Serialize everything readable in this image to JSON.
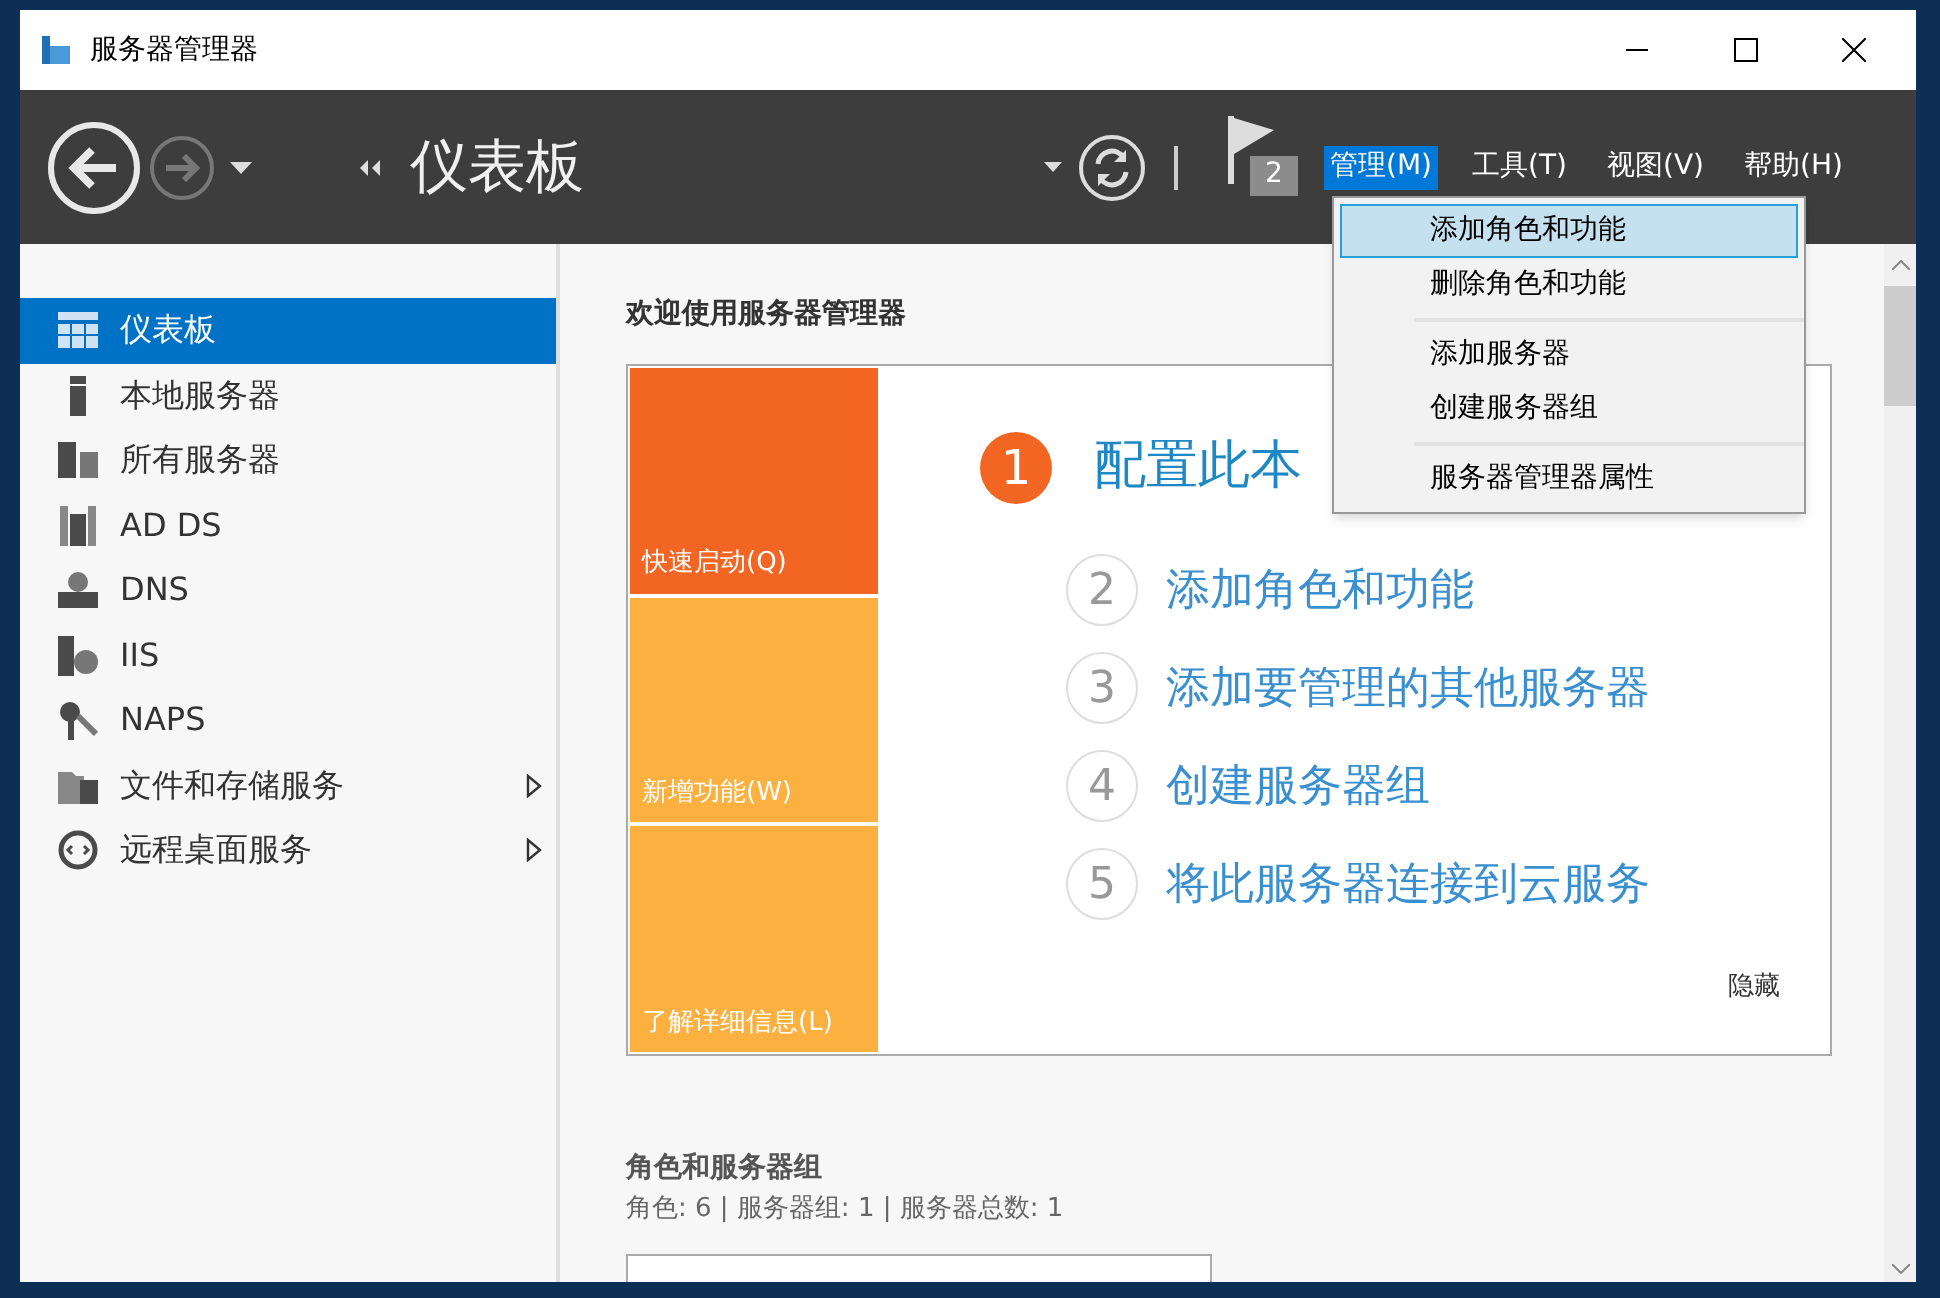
{
  "window": {
    "title": "服务器管理器"
  },
  "nav": {
    "title": "仪表板",
    "flag_count": "2"
  },
  "menus": [
    {
      "label": "管理(M)",
      "selected": true
    },
    {
      "label": "工具(T)",
      "selected": false
    },
    {
      "label": "视图(V)",
      "selected": false
    },
    {
      "label": "帮助(H)",
      "selected": false
    }
  ],
  "dropdown": {
    "groups": [
      [
        {
          "label": "添加角色和功能",
          "selected": true
        },
        {
          "label": "删除角色和功能",
          "selected": false
        }
      ],
      [
        {
          "label": "添加服务器",
          "selected": false
        },
        {
          "label": "创建服务器组",
          "selected": false
        }
      ],
      [
        {
          "label": "服务器管理器属性",
          "selected": false
        }
      ]
    ]
  },
  "sidebar": {
    "items": [
      {
        "label": "仪表板",
        "selected": true,
        "expandable": false
      },
      {
        "label": "本地服务器",
        "selected": false,
        "expandable": false
      },
      {
        "label": "所有服务器",
        "selected": false,
        "expandable": false
      },
      {
        "label": "AD DS",
        "selected": false,
        "expandable": false
      },
      {
        "label": "DNS",
        "selected": false,
        "expandable": false
      },
      {
        "label": "IIS",
        "selected": false,
        "expandable": false
      },
      {
        "label": "NAPS",
        "selected": false,
        "expandable": false
      },
      {
        "label": "文件和存储服务",
        "selected": false,
        "expandable": true
      },
      {
        "label": "远程桌面服务",
        "selected": false,
        "expandable": true
      }
    ]
  },
  "welcome": {
    "heading": "欢迎使用服务器管理器",
    "tiles": [
      {
        "label": "快速启动(Q)",
        "color": "#f26522"
      },
      {
        "label": "新增功能(W)",
        "color": "#fcb040"
      },
      {
        "label": "了解详细信息(L)",
        "color": "#fcb040"
      }
    ],
    "primary_step": {
      "number": "1",
      "label": "配置此本"
    },
    "steps": [
      {
        "number": "2",
        "label": "添加角色和功能"
      },
      {
        "number": "3",
        "label": "添加要管理的其他服务器"
      },
      {
        "number": "4",
        "label": "创建服务器组"
      },
      {
        "number": "5",
        "label": "将此服务器连接到云服务"
      }
    ],
    "hide_link": "隐藏"
  },
  "roles": {
    "title": "角色和服务器组",
    "summary": "角色: 6 | 服务器组: 1 | 服务器总数: 1"
  }
}
